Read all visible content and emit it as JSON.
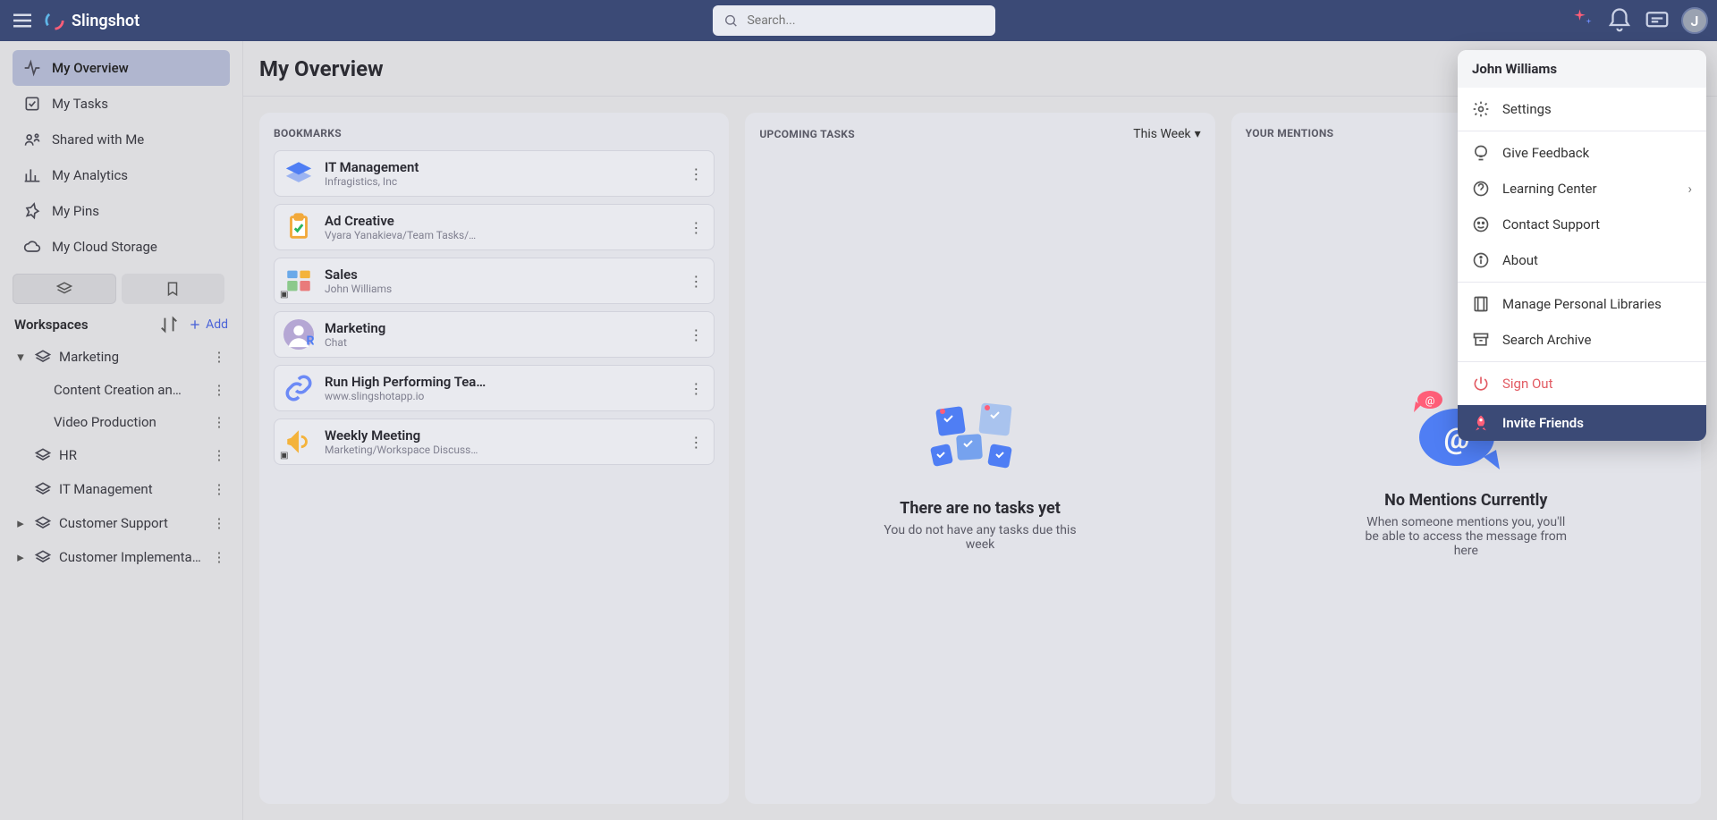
{
  "app_name": "Slingshot",
  "search": {
    "placeholder": "Search..."
  },
  "sidebar": {
    "items": [
      {
        "label": "My Overview",
        "icon": "activity"
      },
      {
        "label": "My Tasks",
        "icon": "task"
      },
      {
        "label": "Shared with Me",
        "icon": "share"
      },
      {
        "label": "My Analytics",
        "icon": "chart"
      },
      {
        "label": "My Pins",
        "icon": "pin"
      },
      {
        "label": "My Cloud Storage",
        "icon": "cloud"
      }
    ],
    "workspaces_label": "Workspaces",
    "add_label": "Add",
    "workspaces": [
      {
        "label": "Marketing",
        "expanded": true,
        "children": [
          {
            "label": "Content Creation an…"
          },
          {
            "label": "Video Production"
          }
        ]
      },
      {
        "label": "HR"
      },
      {
        "label": "IT Management"
      },
      {
        "label": "Customer Support",
        "caret": true
      },
      {
        "label": "Customer Implementa…",
        "caret": true
      }
    ]
  },
  "page_title": "My Overview",
  "panels": {
    "bookmarks": {
      "title": "BOOKMARKS",
      "items": [
        {
          "title": "IT Management",
          "subtitle": "Infragistics, Inc",
          "icon": "layers",
          "color": "#4f7ef4"
        },
        {
          "title": "Ad Creative",
          "subtitle": "Vyara Yanakieva/Team Tasks/…",
          "icon": "clipboard",
          "color": "#f2a93b"
        },
        {
          "title": "Sales",
          "subtitle": "John Williams",
          "icon": "dashboard",
          "color": "#6aa9e9",
          "badge": true
        },
        {
          "title": "Marketing",
          "subtitle": "Chat",
          "icon": "avatar",
          "color": "#b5a7d4"
        },
        {
          "title": "Run High Performing Tea…",
          "subtitle": "www.slingshotapp.io",
          "icon": "link",
          "color": "#6c8af6"
        },
        {
          "title": "Weekly Meeting",
          "subtitle": "Marketing/Workspace Discuss…",
          "icon": "megaphone",
          "color": "#f4b33b",
          "badge": true
        }
      ]
    },
    "tasks": {
      "title": "UPCOMING TASKS",
      "filter": "This Week",
      "empty_title": "There are no tasks yet",
      "empty_text": "You do not have any tasks due this week"
    },
    "mentions": {
      "title": "YOUR MENTIONS",
      "empty_title": "No Mentions Currently",
      "empty_text": "When someone mentions you, you'll be able to access the message from here"
    }
  },
  "profile": {
    "name": "John Williams",
    "email": "                              ",
    "avatar_initial": "J",
    "settings": "Settings",
    "feedback": "Give Feedback",
    "learning": "Learning Center",
    "support": "Contact Support",
    "about": "About",
    "libraries": "Manage Personal Libraries",
    "archive": "Search Archive",
    "signout": "Sign Out",
    "invite": "Invite Friends"
  }
}
